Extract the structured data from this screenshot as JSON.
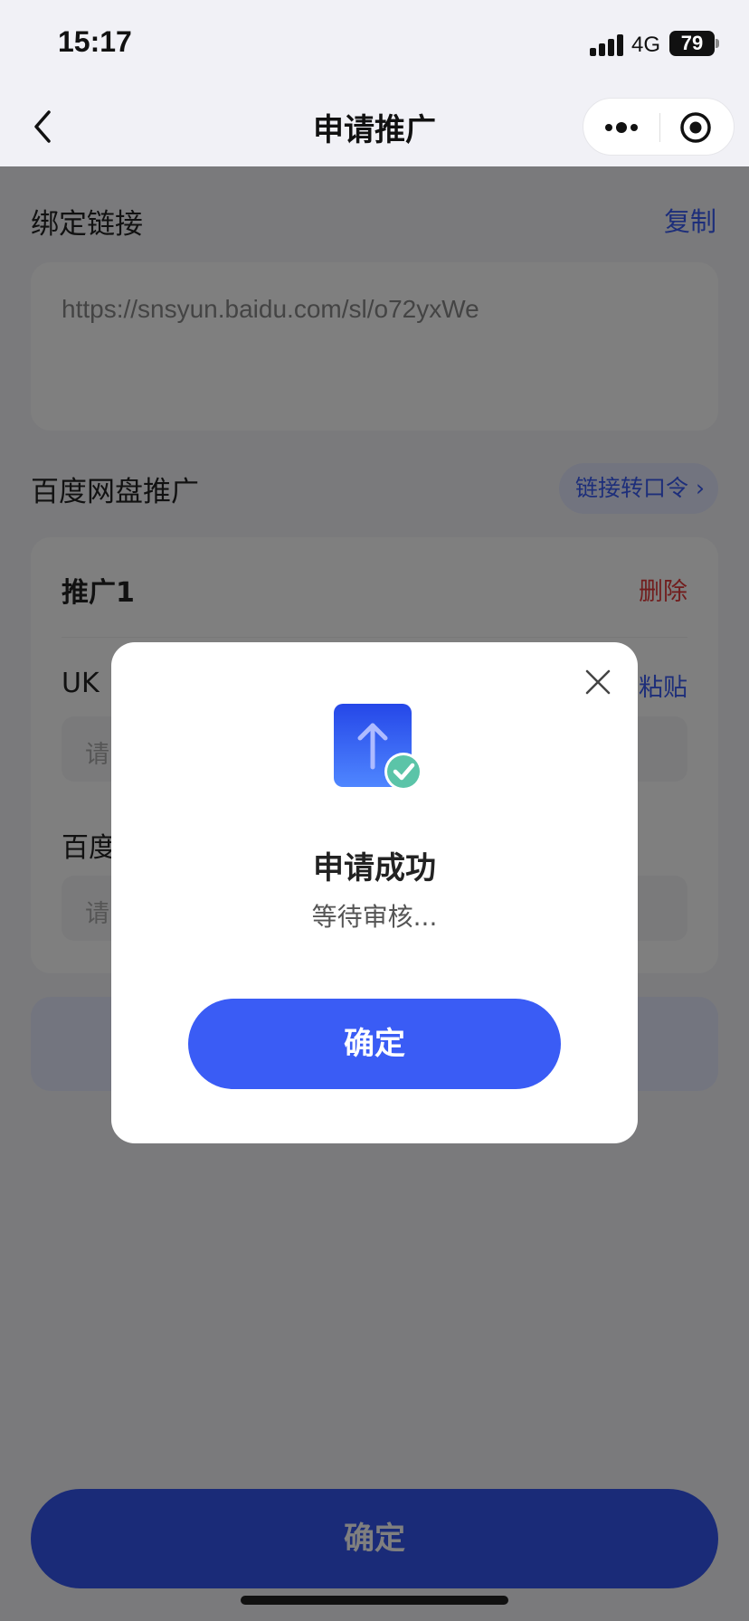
{
  "status_bar": {
    "time": "15:17",
    "network": "4G",
    "battery": "79"
  },
  "nav": {
    "title": "申请推广"
  },
  "bind_link": {
    "title": "绑定链接",
    "copy_label": "复制",
    "url": "https://snsyun.baidu.com/sl/o72yxWe"
  },
  "promo_section": {
    "title": "百度网盘推广",
    "convert_label": "链接转口令 ›",
    "card": {
      "name": "推广1",
      "delete_label": "删除",
      "fields": [
        {
          "label": "UK",
          "action": "粘贴",
          "placeholder": "请"
        },
        {
          "label": "百度",
          "placeholder": "请"
        }
      ]
    }
  },
  "footer": {
    "confirm_label": "确定"
  },
  "modal": {
    "title": "申请成功",
    "subtitle": "等待审核...",
    "confirm_label": "确定",
    "icon": "upload-success-icon",
    "close_icon": "close-icon"
  },
  "colors": {
    "primary": "#3a5cf5",
    "danger": "#e33a3a",
    "success": "#5bc4a8"
  }
}
